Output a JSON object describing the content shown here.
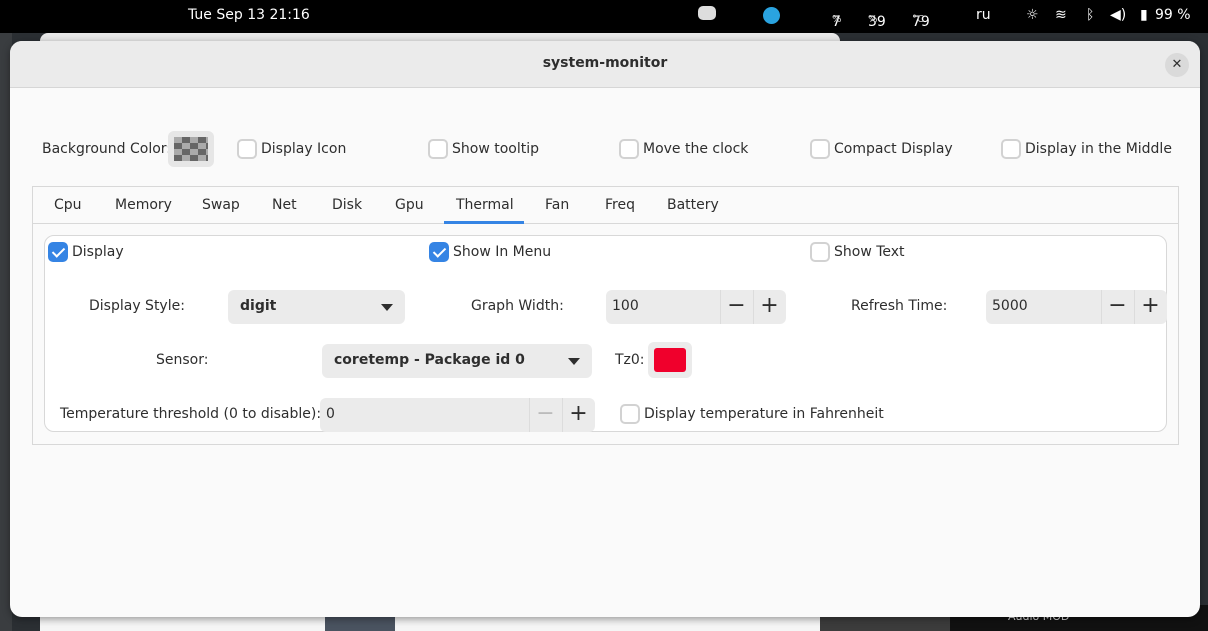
{
  "topbar": {
    "datetime": "Tue Sep 13  21:16",
    "cpu": "7",
    "cpu_unit": "%",
    "mem": "39",
    "mem_unit": "%",
    "temp": "79",
    "temp_unit": "°C",
    "lang": "ru",
    "battery": "99 %"
  },
  "window": {
    "title": "system-monitor"
  },
  "general": {
    "background_color_label": "Background Color:",
    "display_icon": "Display Icon",
    "show_tooltip": "Show tooltip",
    "move_clock": "Move the clock",
    "compact_display": "Compact Display",
    "display_middle": "Display in the Middle"
  },
  "tabs": [
    "Cpu",
    "Memory",
    "Swap",
    "Net",
    "Disk",
    "Gpu",
    "Thermal",
    "Fan",
    "Freq",
    "Battery"
  ],
  "active_tab": "Thermal",
  "thermal": {
    "display": "Display",
    "show_in_menu": "Show In Menu",
    "show_text": "Show Text",
    "display_style_label": "Display Style:",
    "display_style_value": "digit",
    "graph_width_label": "Graph Width:",
    "graph_width_value": "100",
    "refresh_time_label": "Refresh Time:",
    "refresh_time_value": "5000",
    "sensor_label": "Sensor:",
    "sensor_value": "coretemp - Package id 0",
    "tz0_label": "Tz0:",
    "tz0_color": "#f0002c",
    "threshold_label": "Temperature threshold (0 to disable):",
    "threshold_value": "0",
    "fahrenheit": "Display temperature in Fahrenheit"
  },
  "background": {
    "audio_mod": "Audio MOD"
  }
}
